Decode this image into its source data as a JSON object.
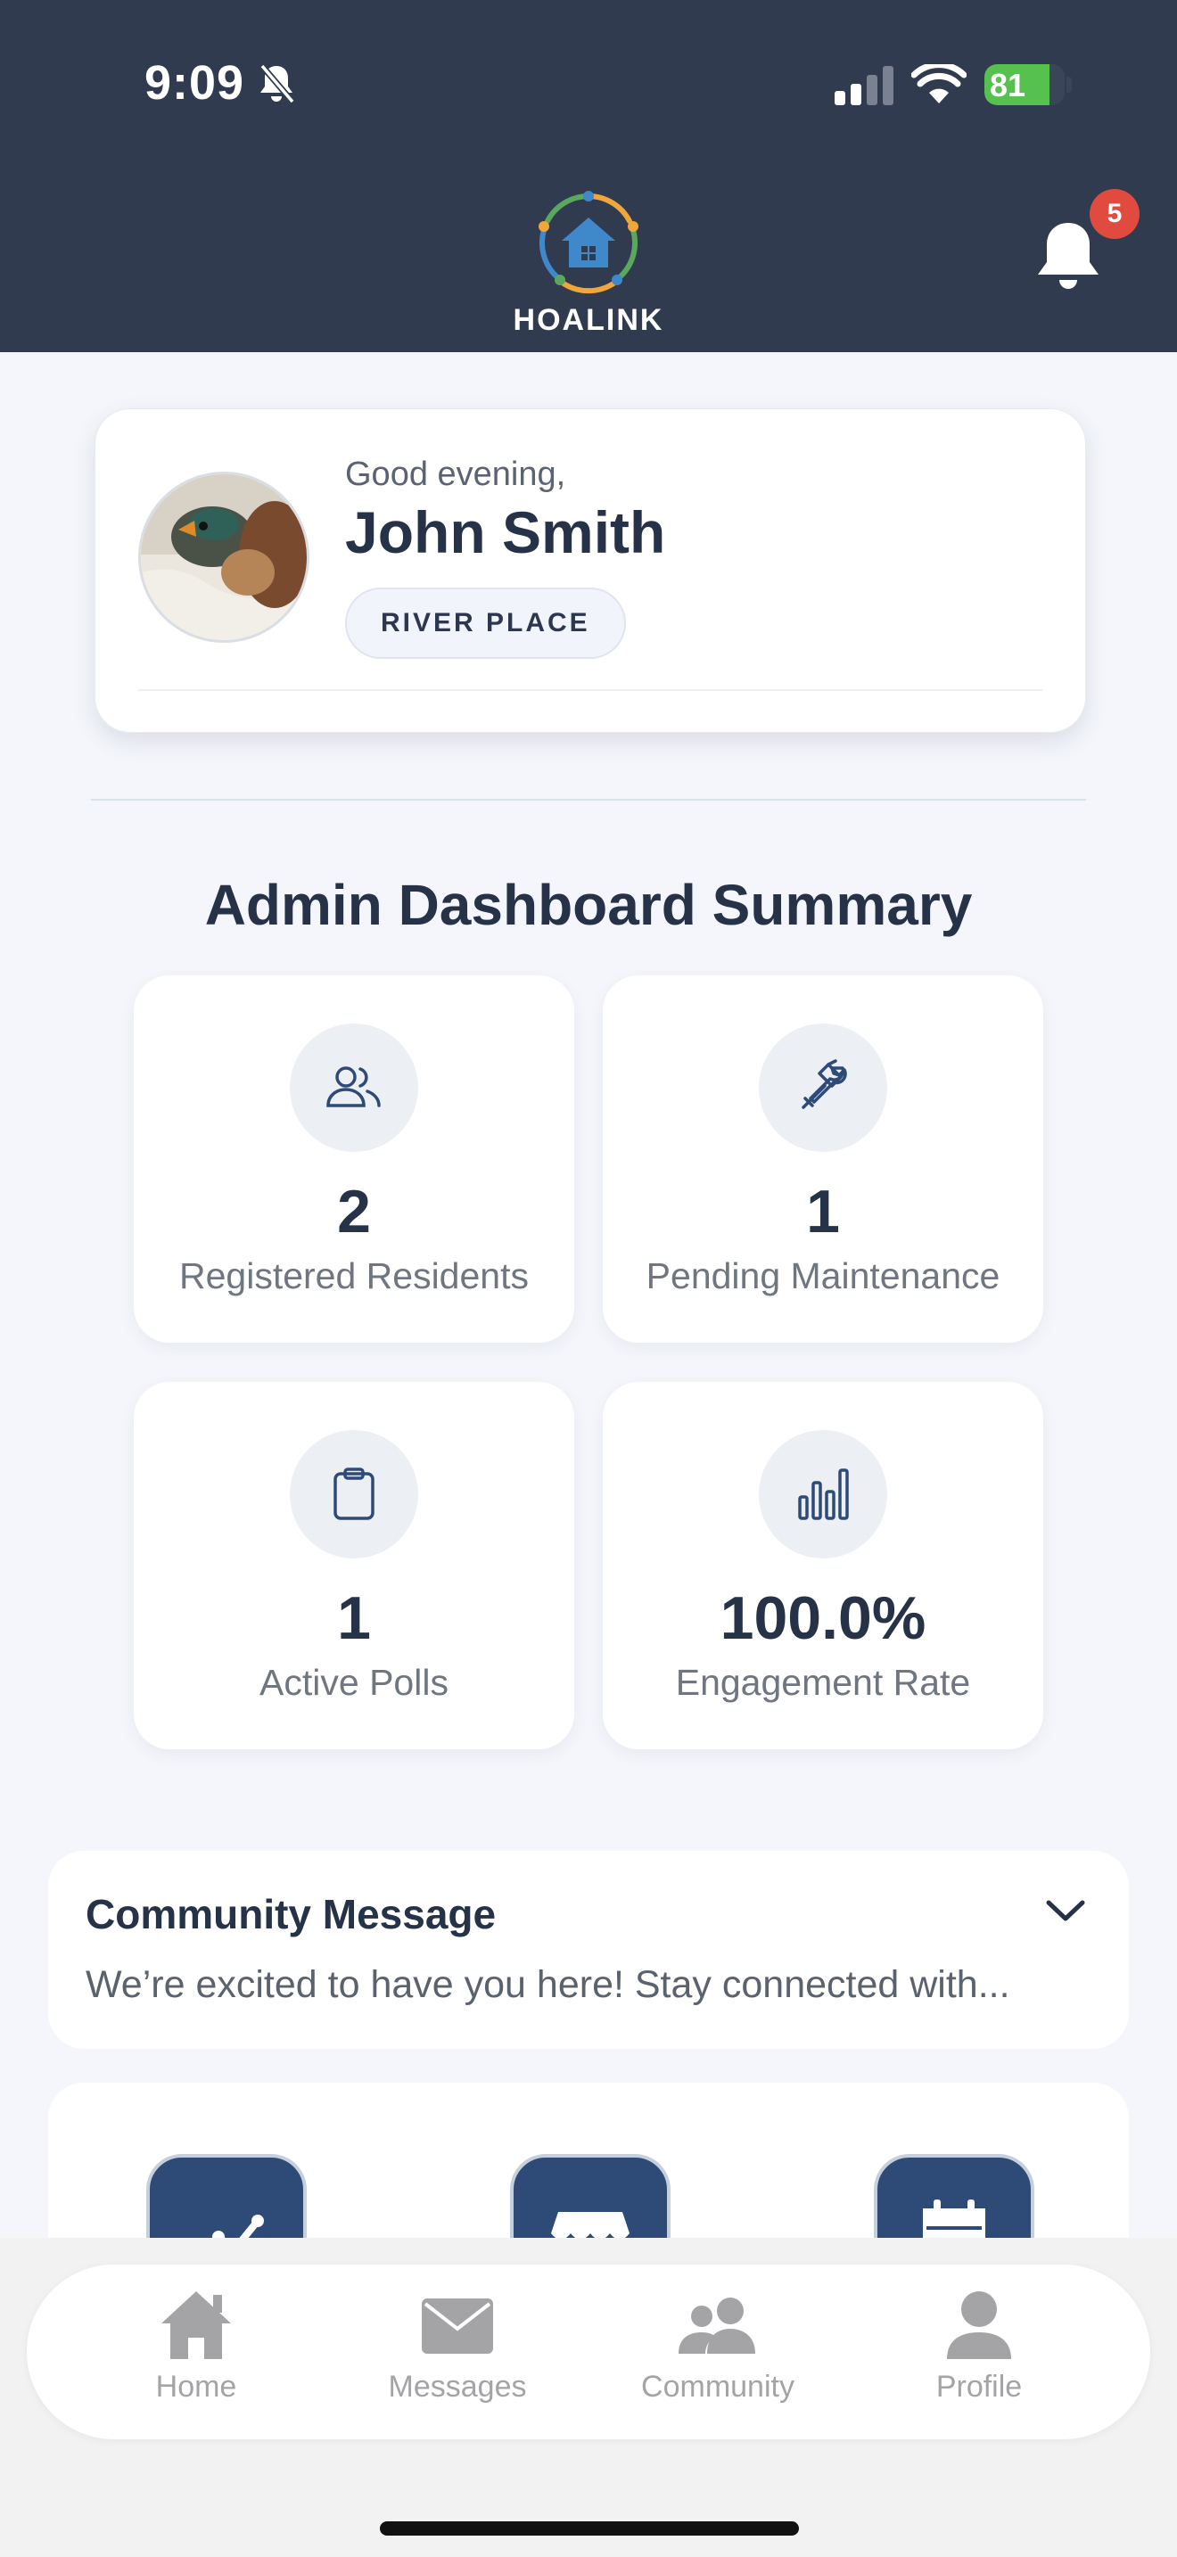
{
  "status_bar": {
    "time": "9:09",
    "battery": "81",
    "battery_level": 0.81
  },
  "header": {
    "brand": "HOALINK",
    "notification_count": "5"
  },
  "profile": {
    "greeting": "Good evening,",
    "name": "John Smith",
    "community": "RIVER PLACE"
  },
  "summary": {
    "title": "Admin Dashboard Summary",
    "stats": [
      {
        "icon": "users-icon",
        "value": "2",
        "label": "Registered Residents"
      },
      {
        "icon": "tools-icon",
        "value": "1",
        "label": "Pending Maintenance"
      },
      {
        "icon": "clipboard-icon",
        "value": "1",
        "label": "Active Polls"
      },
      {
        "icon": "bar-chart-icon",
        "value": "100.0%",
        "label": "Engagement Rate"
      }
    ]
  },
  "community_message": {
    "title": "Community Message",
    "body": "We’re excited to have you here! Stay connected with..."
  },
  "quick_actions": [
    {
      "icon": "trend-chart-icon"
    },
    {
      "icon": "storefront-icon"
    },
    {
      "icon": "calendar-icon"
    }
  ],
  "nav": [
    {
      "icon": "home-icon",
      "label": "Home"
    },
    {
      "icon": "mail-icon",
      "label": "Messages"
    },
    {
      "icon": "community-icon",
      "label": "Community"
    },
    {
      "icon": "person-icon",
      "label": "Profile"
    }
  ],
  "colors": {
    "header_bg": "#303b4f",
    "accent": "#2e4b78",
    "badge": "#e14b3f",
    "battery": "#56c14f"
  }
}
